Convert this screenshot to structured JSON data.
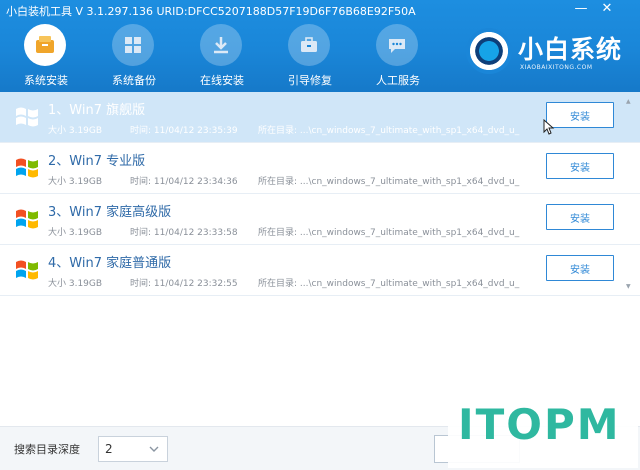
{
  "window": {
    "title": "小白装机工具 V 3.1.297.136 URID:DFCC5207188D57F19D6F76B68E92F50A",
    "minimize_label": "—",
    "close_label": "✕"
  },
  "nav": {
    "items": [
      {
        "label": "系统安装",
        "icon": "disc-icon",
        "active": true
      },
      {
        "label": "系统备份",
        "icon": "backup-icon",
        "active": false
      },
      {
        "label": "在线安装",
        "icon": "download-icon",
        "active": false
      },
      {
        "label": "引导修复",
        "icon": "toolbox-icon",
        "active": false
      },
      {
        "label": "人工服务",
        "icon": "chat-icon",
        "active": false
      }
    ]
  },
  "logo": {
    "name": "小白系统",
    "subtitle": "XIAOBAIXITONG.COM"
  },
  "systems": [
    {
      "name": "1、Win7 旗舰版",
      "size": "大小 3.19GB",
      "time": "时间: 11/04/12 23:35:39",
      "path": "所在目录: ...\\cn_windows_7_ultimate_with_sp1_x64_dvd_u_",
      "button": "安装",
      "selected": true
    },
    {
      "name": "2、Win7 专业版",
      "size": "大小 3.19GB",
      "time": "时间: 11/04/12 23:34:36",
      "path": "所在目录: ...\\cn_windows_7_ultimate_with_sp1_x64_dvd_u_",
      "button": "安装",
      "selected": false
    },
    {
      "name": "3、Win7 家庭高级版",
      "size": "大小 3.19GB",
      "time": "时间: 11/04/12 23:33:58",
      "path": "所在目录: ...\\cn_windows_7_ultimate_with_sp1_x64_dvd_u_",
      "button": "安装",
      "selected": false
    },
    {
      "name": "4、Win7 家庭普通版",
      "size": "大小 3.19GB",
      "time": "时间: 11/04/12 23:32:55",
      "path": "所在目录: ...\\cn_windows_7_ultimate_with_sp1_x64_dvd_u_",
      "button": "安装",
      "selected": false
    }
  ],
  "footer": {
    "depth_label": "搜索目录深度",
    "depth_value": "2"
  },
  "watermark": {
    "text": "ITOPM"
  },
  "colors": {
    "header": "#1a86d8",
    "selected_row": "#d0e6f8",
    "accent": "#2f88d6",
    "watermark": "#2fb8a0"
  }
}
